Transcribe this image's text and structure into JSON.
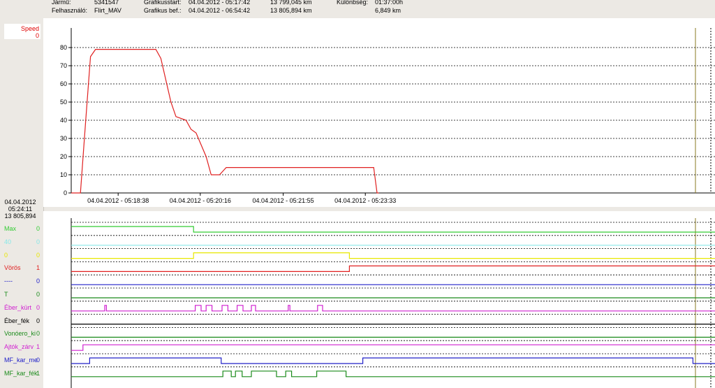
{
  "header": {
    "vehicle_label": "Jármű:",
    "vehicle_value": "5341547",
    "user_label": "Felhasználó:",
    "user_value": "Flirt_MAV",
    "start_label": "Grafikusstart:",
    "start_value": "04.04.2012 - 05:17:42",
    "start_km": "13 799,045 km",
    "end_label": "Grafikus bef.:",
    "end_value": "04.04.2012 - 06:54:42",
    "end_km": "13 805,894 km",
    "diff_label": "Különbség:",
    "diff_time": "01:37:00h",
    "diff_km": "6,849 km"
  },
  "left_panel": {
    "speed_label": "Speed",
    "speed_value": "0",
    "cursor_date": "04.04.2012",
    "cursor_time": "05:24:11",
    "cursor_km": "13 805,894"
  },
  "signals": [
    {
      "label": "Max",
      "value": "0",
      "color": "#33cc33"
    },
    {
      "label": "40",
      "value": "0",
      "color": "#88e8e8"
    },
    {
      "label": "0",
      "value": "0",
      "color": "#e8e800"
    },
    {
      "label": "Vörös",
      "value": "1",
      "color": "#e02020"
    },
    {
      "label": "----",
      "value": "0",
      "color": "#2020c8"
    },
    {
      "label": "T",
      "value": "0",
      "color": "#1a8a1a"
    },
    {
      "label": "Éber_kürt",
      "value": "0",
      "color": "#d020d0"
    },
    {
      "label": "Éber_fék",
      "value": "0",
      "color": "#000000"
    },
    {
      "label": "Vonóero_ki",
      "value": "0",
      "color": "#1a8a1a"
    },
    {
      "label": "Ajtók_zárv",
      "value": "1",
      "color": "#d020d0"
    },
    {
      "label": "MF_kar_me",
      "value": "0",
      "color": "#2020c8"
    },
    {
      "label": "MF_kar_fék",
      "value": "1",
      "color": "#1a8a1a"
    }
  ],
  "chart_data": {
    "type": "line",
    "ylim": [
      0,
      85
    ],
    "yticks": [
      0,
      10,
      20,
      30,
      40,
      50,
      60,
      70,
      80
    ],
    "xticks": [
      "04.04.2012 - 05:18:38",
      "04.04.2012 - 05:20:16",
      "04.04.2012 - 05:21:55",
      "04.04.2012 - 05:23:33"
    ],
    "series": [
      {
        "color": "#e02020",
        "x": [
          "05:17:42",
          "05:17:53",
          "05:17:59",
          "05:18:05",
          "05:18:11",
          "05:18:17",
          "05:18:29",
          "05:18:41",
          "05:19:05",
          "05:19:23",
          "05:19:29",
          "05:19:41",
          "05:19:47",
          "05:19:59",
          "05:20:05",
          "05:20:11",
          "05:20:23",
          "05:20:29",
          "05:20:39",
          "05:20:47",
          "05:21:00",
          "05:21:05",
          "05:21:37",
          "05:23:43",
          "05:23:47",
          "05:23:49"
        ],
        "values": [
          0,
          0,
          38,
          75,
          79,
          79,
          79,
          79,
          79,
          79,
          74,
          50,
          42,
          40,
          35,
          33,
          20,
          10,
          10,
          14,
          14,
          14,
          14,
          14,
          0,
          0
        ]
      }
    ],
    "digital_x_range": [
      "05:17:42",
      "05:24:00"
    ]
  }
}
